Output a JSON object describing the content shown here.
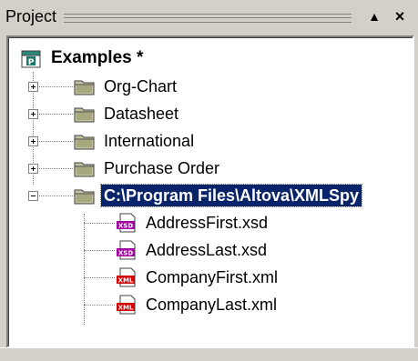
{
  "panel": {
    "title": "Project",
    "pin_glyph": "▲",
    "close_glyph": "×"
  },
  "tree": {
    "root": {
      "label": "Examples *",
      "icon": "project-icon"
    },
    "folders": [
      {
        "label": "Org-Chart",
        "expanded": false
      },
      {
        "label": "Datasheet",
        "expanded": false
      },
      {
        "label": "International",
        "expanded": false
      },
      {
        "label": "Purchase Order",
        "expanded": false
      },
      {
        "label": "C:\\Program Files\\Altova\\XMLSpy",
        "expanded": true,
        "selected": true
      }
    ],
    "files": [
      {
        "label": "AddressFirst.xsd",
        "icon": "xsd-file-icon"
      },
      {
        "label": "AddressLast.xsd",
        "icon": "xsd-file-icon"
      },
      {
        "label": "CompanyFirst.xml",
        "icon": "xml-file-icon"
      },
      {
        "label": "CompanyLast.xml",
        "icon": "xml-file-icon"
      }
    ],
    "icon_text": {
      "xsd": "XSD",
      "xml": "XML"
    }
  },
  "colors": {
    "selection": "#0a246a",
    "folder": "#c4c4a0",
    "xsd_badge": "#a000a0",
    "xml_badge": "#d00000"
  }
}
